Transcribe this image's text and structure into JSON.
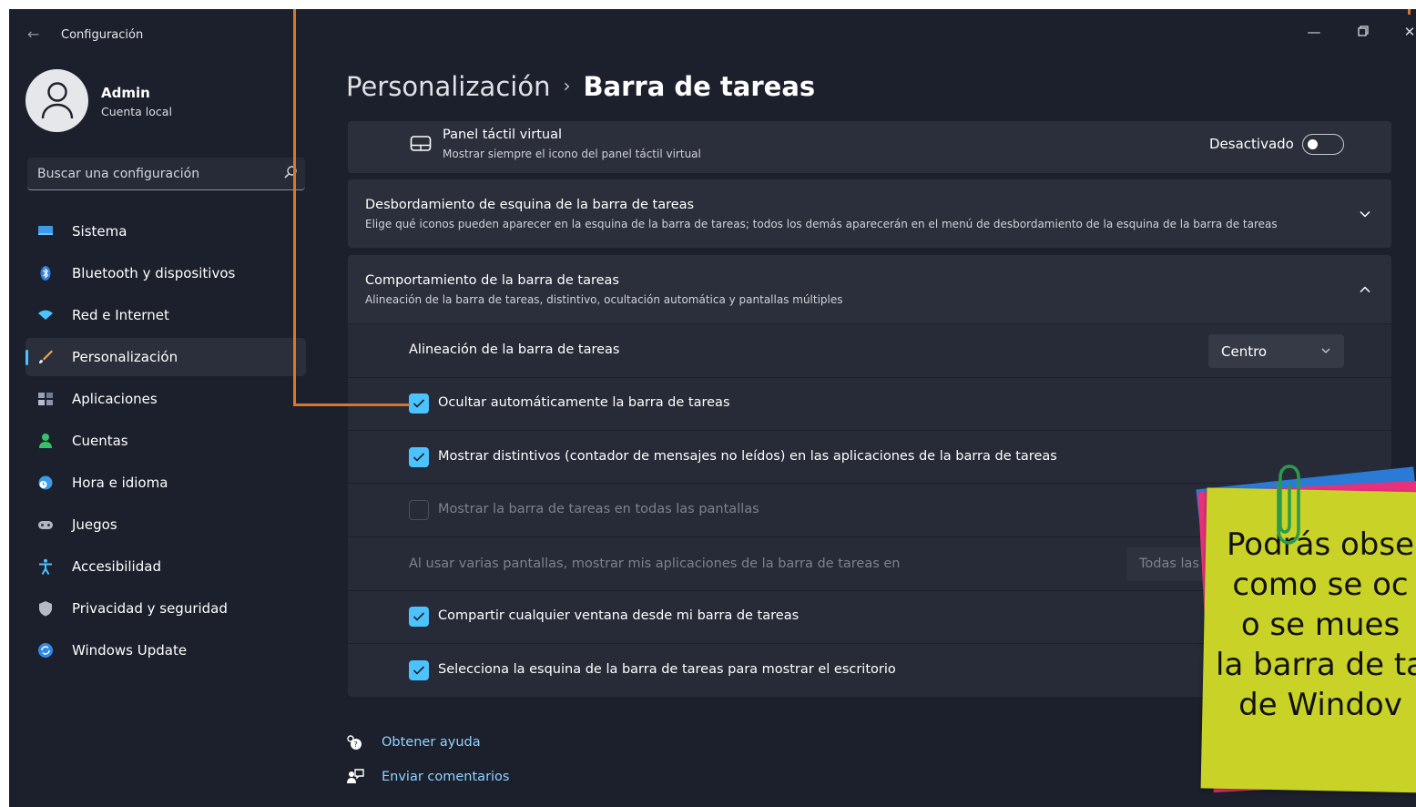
{
  "window": {
    "title": "Configuración",
    "back_icon": "back-arrow-icon",
    "controls": [
      "minimize-icon",
      "restore-icon",
      "close-icon"
    ]
  },
  "user": {
    "name": "Admin",
    "account_type": "Cuenta local",
    "avatar_icon": "person-icon"
  },
  "search": {
    "placeholder": "Buscar una configuración",
    "icon": "search-icon"
  },
  "sidebar": {
    "items": [
      {
        "label": "Sistema",
        "icon": "monitor-icon",
        "active": false
      },
      {
        "label": "Bluetooth y dispositivos",
        "icon": "bluetooth-icon",
        "active": false
      },
      {
        "label": "Red e Internet",
        "icon": "wifi-icon",
        "active": false
      },
      {
        "label": "Personalización",
        "icon": "brush-icon",
        "active": true
      },
      {
        "label": "Aplicaciones",
        "icon": "apps-icon",
        "active": false
      },
      {
        "label": "Cuentas",
        "icon": "account-icon",
        "active": false
      },
      {
        "label": "Hora e idioma",
        "icon": "globe-clock-icon",
        "active": false
      },
      {
        "label": "Juegos",
        "icon": "gamepad-icon",
        "active": false
      },
      {
        "label": "Accesibilidad",
        "icon": "accessibility-icon",
        "active": false
      },
      {
        "label": "Privacidad y seguridad",
        "icon": "shield-icon",
        "active": false
      },
      {
        "label": "Windows Update",
        "icon": "update-icon",
        "active": false
      }
    ]
  },
  "breadcrumb": {
    "parent": "Personalización",
    "separator": "›",
    "current": "Barra de tareas"
  },
  "settings": {
    "touchpad": {
      "title": "Panel táctil virtual",
      "subtitle": "Mostrar siempre el icono del panel táctil virtual",
      "state_label": "Desactivado",
      "enabled": false
    },
    "overflow": {
      "title": "Desbordamiento de esquina de la barra de tareas",
      "subtitle": "Elige qué iconos pueden aparecer en la esquina de la barra de tareas; todos los demás aparecerán en el menú de desbordamiento de la esquina de la barra de tareas",
      "expanded": false
    },
    "behavior": {
      "title": "Comportamiento de la barra de tareas",
      "subtitle": "Alineación de la barra de tareas, distintivo, ocultación automática y pantallas múltiples",
      "expanded": true,
      "alignment": {
        "label": "Alineación de la barra de tareas",
        "value": "Centro"
      },
      "autohide": {
        "label": "Ocultar automáticamente la barra de tareas",
        "checked": true
      },
      "badges": {
        "label": "Mostrar distintivos (contador de mensajes no leídos) en las aplicaciones de la barra de tareas",
        "checked": true
      },
      "all_displays": {
        "label": "Mostrar la barra de tareas en todas las pantallas",
        "checked": false,
        "disabled": true
      },
      "multi_display": {
        "label": "Al usar varias pantallas, mostrar mis aplicaciones de la barra de tareas en",
        "value": "Todas las",
        "disabled": true
      },
      "share_window": {
        "label": "Compartir cualquier ventana desde mi barra de tareas",
        "checked": true
      },
      "corner_desktop": {
        "label": "Selecciona la esquina de la barra de tareas para mostrar el escritorio",
        "checked": true
      }
    }
  },
  "footer": {
    "help": "Obtener ayuda",
    "feedback": "Enviar comentarios"
  },
  "sticky_note": {
    "lines": [
      "Podrás obse",
      "como se oc",
      "o se mues",
      "la barra de ta",
      "de Windov"
    ]
  },
  "colors": {
    "accent": "#4cc2ff",
    "annotation": "#d8772a",
    "note": "#c8d227"
  }
}
